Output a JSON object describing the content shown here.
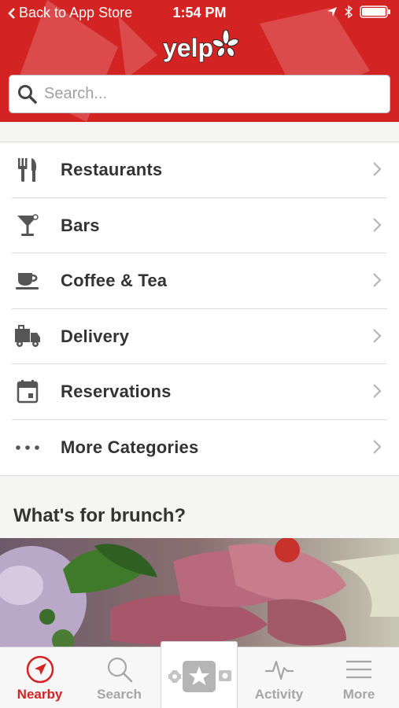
{
  "status_bar": {
    "back_label": "Back to App Store",
    "time": "1:54 PM"
  },
  "header": {
    "logo_text": "yelp",
    "search": {
      "placeholder": "Search..."
    }
  },
  "categories": [
    {
      "label": "Restaurants",
      "icon": "fork-knife-icon"
    },
    {
      "label": "Bars",
      "icon": "cocktail-icon"
    },
    {
      "label": "Coffee & Tea",
      "icon": "coffee-cup-icon"
    },
    {
      "label": "Delivery",
      "icon": "delivery-truck-icon"
    },
    {
      "label": "Reservations",
      "icon": "calendar-icon"
    },
    {
      "label": "More Categories",
      "icon": "more-dots-icon"
    }
  ],
  "section": {
    "title": "What's for brunch?"
  },
  "tabbar": {
    "tabs": [
      {
        "label": "Nearby",
        "icon": "compass-icon",
        "active": true
      },
      {
        "label": "Search",
        "icon": "search-icon",
        "active": false
      },
      {
        "label": "",
        "icon": "review-star-icon",
        "active": false
      },
      {
        "label": "Activity",
        "icon": "pulse-icon",
        "active": false
      },
      {
        "label": "More",
        "icon": "hamburger-menu-icon",
        "active": false
      }
    ]
  },
  "colors": {
    "brand_red": "#d32323",
    "text_dark": "#333333",
    "icon_gray": "#555555",
    "tab_inactive": "#a6a6a6"
  }
}
